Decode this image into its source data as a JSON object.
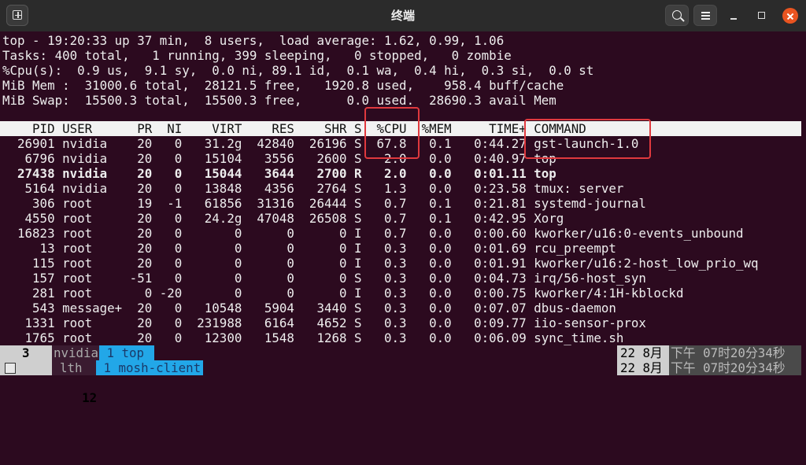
{
  "window": {
    "title": "终端",
    "icons": {
      "new_tab": "new-tab-icon",
      "search": "search-icon",
      "menu": "hamburger-menu-icon",
      "minimize": "minimize-icon",
      "maximize": "maximize-icon",
      "close": "close-icon"
    }
  },
  "summary": [
    "top - 19:20:33 up 37 min,  8 users,  load average: 1.62, 0.99, 1.06",
    "Tasks: 400 total,   1 running, 399 sleeping,   0 stopped,   0 zombie",
    "%Cpu(s):  0.9 us,  9.1 sy,  0.0 ni, 89.1 id,  0.1 wa,  0.4 hi,  0.3 si,  0.0 st",
    "MiB Mem :  31000.6 total,  28121.5 free,   1920.8 used,    958.4 buff/cache",
    "MiB Swap:  15500.3 total,  15500.3 free,      0.0 used.  28690.3 avail Mem"
  ],
  "table_header": "    PID USER      PR  NI    VIRT    RES    SHR S  %CPU  %MEM     TIME+ COMMAND",
  "rows": [
    "  26901 nvidia    20   0   31.2g  42840  26196 S  67.8   0.1   0:44.27 gst-launch-1.0",
    "   6796 nvidia    20   0   15104   3556   2600 S   2.0   0.0   0:40.97 top",
    "  27438 nvidia    20   0   15044   3644   2700 R   2.0   0.0   0:01.11 top",
    "   5164 nvidia    20   0   13848   4356   2764 S   1.3   0.0   0:23.58 tmux: server",
    "    306 root      19  -1   61856  31316  26444 S   0.7   0.1   0:21.81 systemd-journal",
    "   4550 root      20   0   24.2g  47048  26508 S   0.7   0.1   0:42.95 Xorg",
    "  16823 root      20   0       0      0      0 I   0.7   0.0   0:00.60 kworker/u16:0-events_unbound",
    "     13 root      20   0       0      0      0 I   0.3   0.0   0:01.69 rcu_preempt",
    "    115 root      20   0       0      0      0 I   0.3   0.0   0:01.91 kworker/u16:2-host_low_prio_wq",
    "    157 root     -51   0       0      0      0 S   0.3   0.0   0:04.73 irq/56-host_syn",
    "    281 root       0 -20       0      0      0 I   0.3   0.0   0:00.75 kworker/4:1H-kblockd",
    "    543 message+  20   0   10548   5904   3440 S   0.3   0.0   0:07.07 dbus-daemon",
    "   1331 root      20   0  231988   6164   4652 S   0.3   0.0   0:09.77 iio-sensor-prox",
    "   1765 root      20   0   12300   1548   1268 S   0.3   0.0   0:06.09 sync_time.sh"
  ],
  "bold_row_index": 2,
  "status_bars": [
    {
      "num": "3",
      "host": "nvidia",
      "active": " 1 top",
      "date": "22 8月",
      "time": "下午 07时20分34秒"
    },
    {
      "num": "12",
      "host": "lth",
      "active": " 1 mosh-client",
      "date": "22 8月",
      "time": "下午 07时20分34秒"
    }
  ],
  "highlight_color": "#e0393e"
}
